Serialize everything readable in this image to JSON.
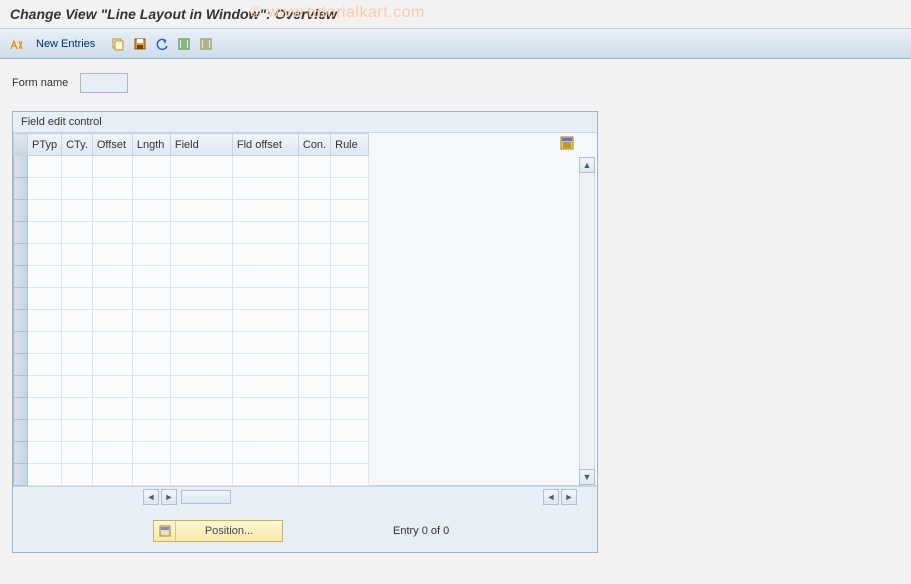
{
  "title": "Change View \"Line Layout in Window\": Overview",
  "watermark": "© www.tutorialkart.com",
  "toolbar": {
    "new_entries": "New Entries"
  },
  "form": {
    "name_label": "Form name",
    "name_value": ""
  },
  "panel": {
    "title": "Field edit control",
    "columns": {
      "ptyp": "PTyp",
      "cty": "CTy.",
      "offset": "Offset",
      "lngth": "Lngth",
      "field": "Field",
      "fldoffset": "Fld offset",
      "con": "Con.",
      "rule": "Rule"
    },
    "position_label": "Position...",
    "entry_text": "Entry 0 of 0"
  }
}
